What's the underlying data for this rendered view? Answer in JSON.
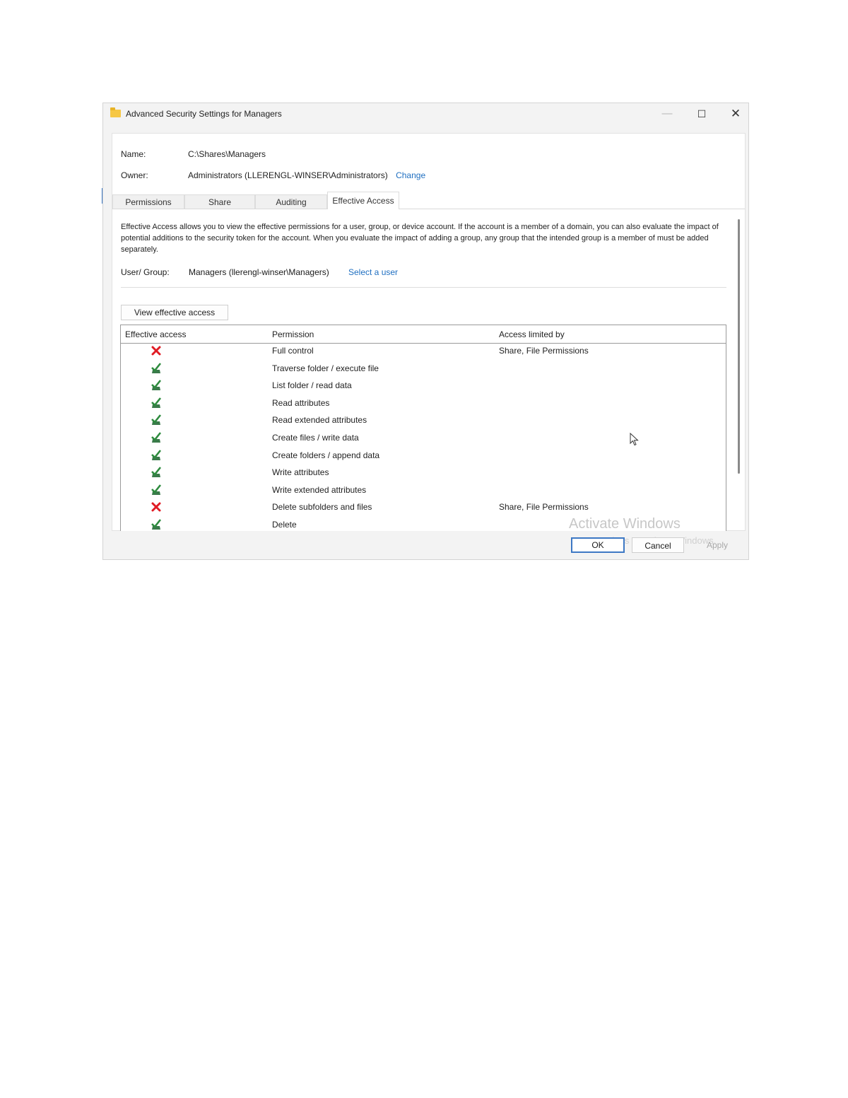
{
  "window": {
    "title": "Advanced Security Settings for Managers",
    "minimize": "—",
    "maximize": "☐",
    "close": "✕"
  },
  "info": {
    "name_label": "Name:",
    "name_value": "C:\\Shares\\Managers",
    "owner_label": "Owner:",
    "owner_value": "Administrators (LLERENGL-WINSER\\Administrators)",
    "change_link": "Change"
  },
  "tabs": [
    "Permissions",
    "Share",
    "Auditing",
    "Effective Access"
  ],
  "active_tab": "Effective Access",
  "effective": {
    "description": "Effective Access allows you to view the effective permissions for a user, group, or device account. If the account is a member of a domain, you can also evaluate the impact of potential additions to the security token for the account. When you evaluate the impact of adding a group, any group that the intended group is a member of must be added separately.",
    "user_group_label": "User/ Group:",
    "user_group_value": "Managers (llerengl-winser\\Managers)",
    "select_user_link": "Select a user",
    "view_button": "View effective access"
  },
  "grid": {
    "headers": [
      "Effective access",
      "Permission",
      "Access limited by"
    ],
    "rows": [
      {
        "allowed": false,
        "permission": "Full control",
        "limited_by": "Share, File Permissions"
      },
      {
        "allowed": true,
        "permission": "Traverse folder / execute file",
        "limited_by": ""
      },
      {
        "allowed": true,
        "permission": "List folder / read data",
        "limited_by": ""
      },
      {
        "allowed": true,
        "permission": "Read attributes",
        "limited_by": ""
      },
      {
        "allowed": true,
        "permission": "Read extended attributes",
        "limited_by": ""
      },
      {
        "allowed": true,
        "permission": "Create files / write data",
        "limited_by": ""
      },
      {
        "allowed": true,
        "permission": "Create folders / append data",
        "limited_by": ""
      },
      {
        "allowed": true,
        "permission": "Write attributes",
        "limited_by": ""
      },
      {
        "allowed": true,
        "permission": "Write extended attributes",
        "limited_by": ""
      },
      {
        "allowed": false,
        "permission": "Delete subfolders and files",
        "limited_by": "Share, File Permissions"
      },
      {
        "allowed": true,
        "permission": "Delete",
        "limited_by": ""
      }
    ]
  },
  "watermark": {
    "line1": "Activate Windows",
    "line2": "Go to Settings to activate Windows."
  },
  "buttons": {
    "ok": "OK",
    "cancel": "Cancel",
    "apply": "Apply"
  },
  "colors": {
    "deny": "#e01b24",
    "allow": "#2e8b3e",
    "link": "#1f6fc1"
  },
  "icons": {
    "deny": "red-x-icon",
    "allow": "green-check-icon"
  }
}
